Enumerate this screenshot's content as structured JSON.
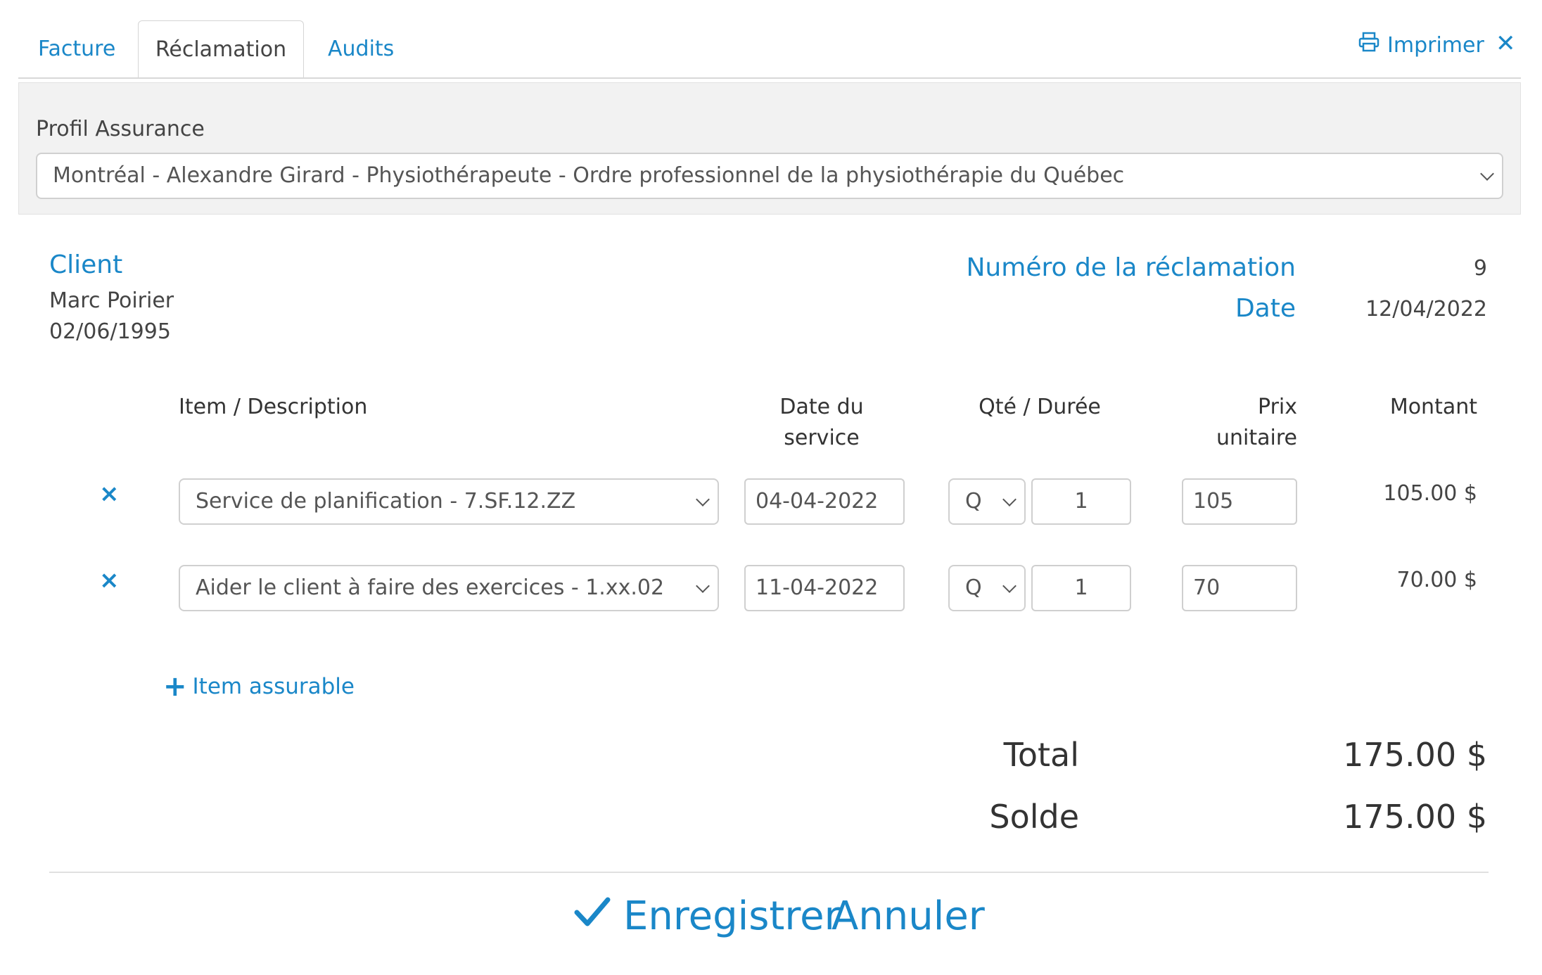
{
  "tabs": [
    {
      "label": "Facture"
    },
    {
      "label": "Réclamation"
    },
    {
      "label": "Audits"
    }
  ],
  "print_label": "Imprimer",
  "insurance": {
    "label": "Profil Assurance",
    "selected": "Montréal - Alexandre Girard - Physiothérapeute - Ordre professionnel de la physiothérapie du Québec"
  },
  "client": {
    "title": "Client",
    "name": "Marc Poirier",
    "birthdate": "02/06/1995"
  },
  "claim": {
    "number_label": "Numéro de la réclamation",
    "number": "9",
    "date_label": "Date",
    "date": "12/04/2022"
  },
  "table": {
    "headers": {
      "item": "Item / Description",
      "date_line1": "Date du",
      "date_line2": "service",
      "qty": "Qté / Durée",
      "price_line1": "Prix",
      "price_line2": "unitaire",
      "amount": "Montant"
    },
    "rows": [
      {
        "item": "Service de planification - 7.SF.12.ZZ",
        "date": "04-04-2022",
        "unit": "Q",
        "qty": "1",
        "price": "105",
        "amount": "105.00 $"
      },
      {
        "item": "Aider le client à faire des exercices - 1.xx.02",
        "date": "11-04-2022",
        "unit": "Q",
        "qty": "1",
        "price": "70",
        "amount": "70.00 $"
      }
    ],
    "remove_symbol": "×",
    "add_label": "Item assurable"
  },
  "totals": {
    "total_label": "Total",
    "total_value": "175.00 $",
    "balance_label": "Solde",
    "balance_value": "175.00 $"
  },
  "actions": {
    "save_label": "Enregistrer",
    "cancel_label": "Annuler"
  },
  "colors": {
    "accent": "#1a87c8"
  }
}
